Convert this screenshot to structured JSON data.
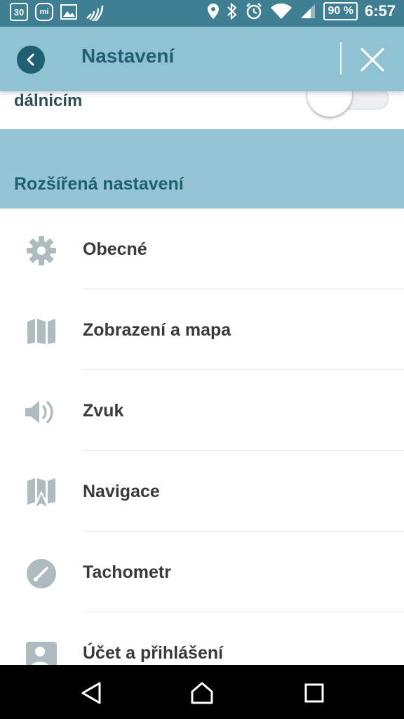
{
  "status_bar": {
    "calendar_day": "30",
    "battery": "90 %",
    "time": "6:57",
    "icons": [
      "calendar-icon",
      "mi-app-icon",
      "gallery-icon",
      "nfc-icon",
      "location-icon",
      "bluetooth-icon",
      "alarm-icon",
      "wifi-icon",
      "signal-icon",
      "battery-icon"
    ]
  },
  "appbar": {
    "title": "Nastavení"
  },
  "highway_row": {
    "label": "dálnicím",
    "toggle_on": false
  },
  "section": {
    "title": "Rozšířená nastavení"
  },
  "menu": {
    "items": [
      {
        "label": "Obecné",
        "icon": "gear-icon"
      },
      {
        "label": "Zobrazení a mapa",
        "icon": "map-icon"
      },
      {
        "label": "Zvuk",
        "icon": "speaker-icon"
      },
      {
        "label": "Navigace",
        "icon": "navigation-map-icon"
      },
      {
        "label": "Tachometr",
        "icon": "speedometer-icon"
      },
      {
        "label": "Účet a přihlášení",
        "icon": "account-icon"
      }
    ]
  },
  "colors": {
    "status_bar": "#3f7f93",
    "app_bar": "#8fc2d2",
    "section_header": "#95c6d5",
    "accent_dark": "#1f5f74",
    "icon_gray": "#aebcc2"
  }
}
